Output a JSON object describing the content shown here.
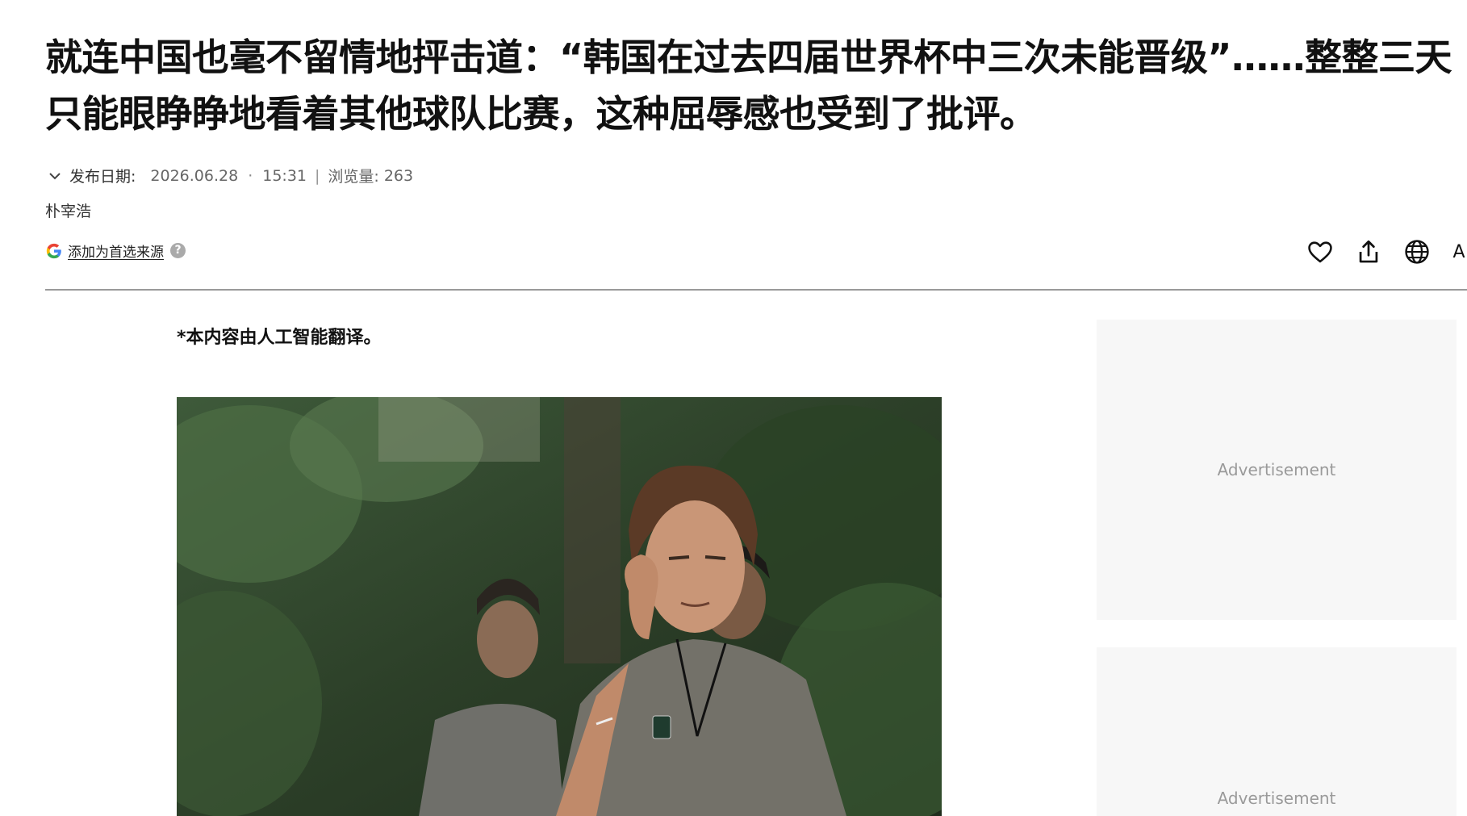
{
  "article": {
    "headline_line1": "就连中国也毫不留情地抨击道：“韩国在过去四届世界杯中三次未能晋级”……整整三天",
    "headline_line2": "只能眼睁睁地看着其他球队比赛，这种屈辱感也受到了批评。",
    "meta": {
      "date_label": "发布日期:",
      "date": "2026.06.28",
      "time": "15:31",
      "views_label": "浏览量:",
      "views": "263"
    },
    "author": "朴宰浩",
    "google_source_label": "添加为首选来源",
    "ai_note": "*本内容由人工智能翻译。"
  },
  "toolbar": {
    "icons": [
      "heart-icon",
      "share-icon",
      "globe-icon",
      "font-size-icon"
    ],
    "font_label": "A"
  },
  "ads": [
    {
      "label": "Advertisement"
    },
    {
      "label": "Advertisement"
    }
  ],
  "colors": {
    "rule": "#9a9a9a",
    "ad_bg": "#f7f7f7",
    "ad_text": "#9a9a9a"
  }
}
